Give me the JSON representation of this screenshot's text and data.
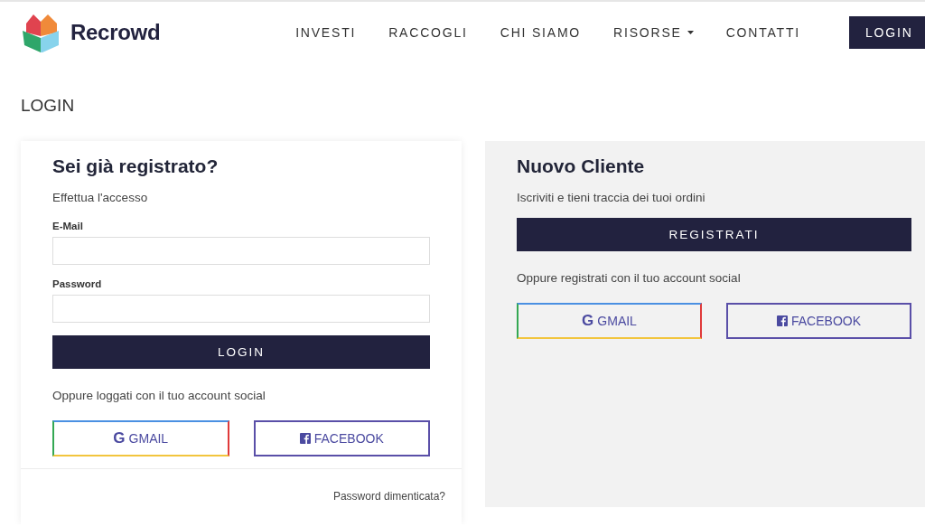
{
  "header": {
    "brand": "Recrowd",
    "nav": [
      {
        "label": "INVESTI",
        "dropdown": false
      },
      {
        "label": "RACCOGLI",
        "dropdown": false
      },
      {
        "label": "CHI SIAMO",
        "dropdown": false
      },
      {
        "label": "RISORSE",
        "dropdown": true
      },
      {
        "label": "CONTATTI",
        "dropdown": false
      }
    ],
    "login_button": "LOGIN"
  },
  "page_title": "LOGIN",
  "login_card": {
    "title": "Sei già registrato?",
    "subtitle": "Effettua l'accesso",
    "fields": [
      {
        "label": "E-Mail"
      },
      {
        "label": "Password"
      }
    ],
    "submit": "LOGIN",
    "social_text": "Oppure loggati con il tuo account social",
    "social": [
      {
        "kind": "google",
        "icon": "G",
        "label": "GMAIL"
      },
      {
        "kind": "facebook",
        "label": "FACEBOOK"
      }
    ],
    "forgot_link": "Password dimenticata?"
  },
  "register_panel": {
    "title": "Nuovo Cliente",
    "subtitle": "Iscriviti e tieni traccia dei tuoi ordini",
    "submit": "REGISTRATI",
    "social_text": "Oppure registrati con il tuo account social",
    "social": [
      {
        "kind": "google",
        "icon": "G",
        "label": "GMAIL"
      },
      {
        "kind": "facebook",
        "label": "FACEBOOK"
      }
    ]
  }
}
